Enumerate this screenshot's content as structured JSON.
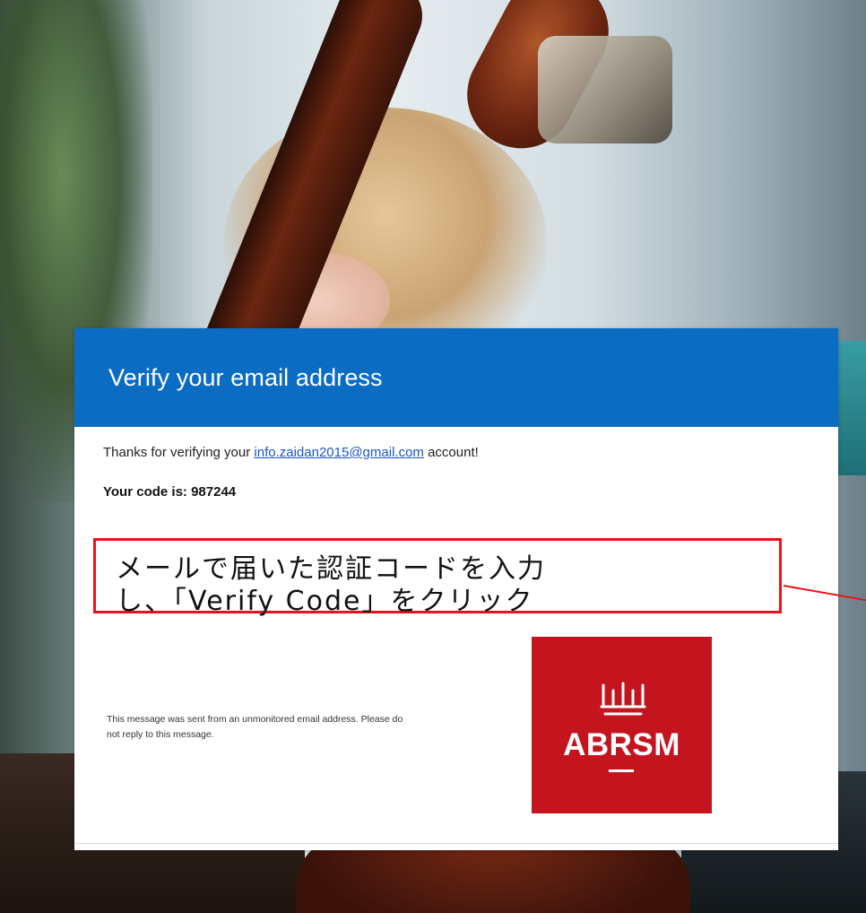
{
  "email": {
    "header_title": "Verify your email address",
    "thanks_prefix": "Thanks for verifying your ",
    "email_address": "info.zaidan2015@gmail.com",
    "thanks_suffix": " account!",
    "code_text": "Your code is: 987244",
    "footer_note": "This message was sent from an unmonitored email address. Please do not reply to this message.",
    "logo_text": "ABRSM",
    "header_color": "#0b6cc4",
    "logo_color": "#c4151f"
  },
  "annotation": {
    "text": "メールで届いた認証コードを入力\nし、「Verify Code」をクリック",
    "border_color": "#e8141c"
  }
}
